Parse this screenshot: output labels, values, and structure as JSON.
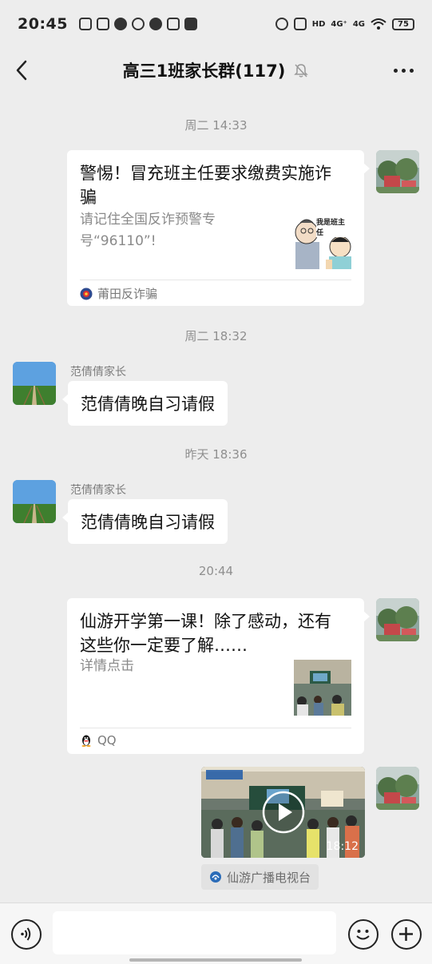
{
  "status_bar": {
    "time": "20:45",
    "signal_1": "4G⁺",
    "signal_2": "4G",
    "battery": "75"
  },
  "header": {
    "title": "高三1班家长群(117)"
  },
  "timestamps": [
    "周二 14:33",
    "周二 18:32",
    "昨天 18:36",
    "20:44"
  ],
  "messages": {
    "card1": {
      "title": "警惕！冒充班主任要求缴费实施诈骗",
      "desc": "请记住全国反诈预警专号“96110”!",
      "thumb_caption": "我是班主任",
      "source": "莆田反诈骗"
    },
    "text1": {
      "sender": "范倩倩家长",
      "text": "范倩倩晚自习请假"
    },
    "text2": {
      "sender": "范倩倩家长",
      "text": "范倩倩晚自习请假"
    },
    "card2": {
      "title": "仙游开学第一课！除了感动，还有这些你一定要了解……",
      "desc": "详情点击",
      "source": "QQ"
    },
    "video": {
      "duration": "18:12",
      "channel": "仙游广播电视台"
    }
  },
  "colors": {
    "background": "#ededed",
    "bubble": "#ffffff",
    "timestamp": "#8f8f8f"
  }
}
